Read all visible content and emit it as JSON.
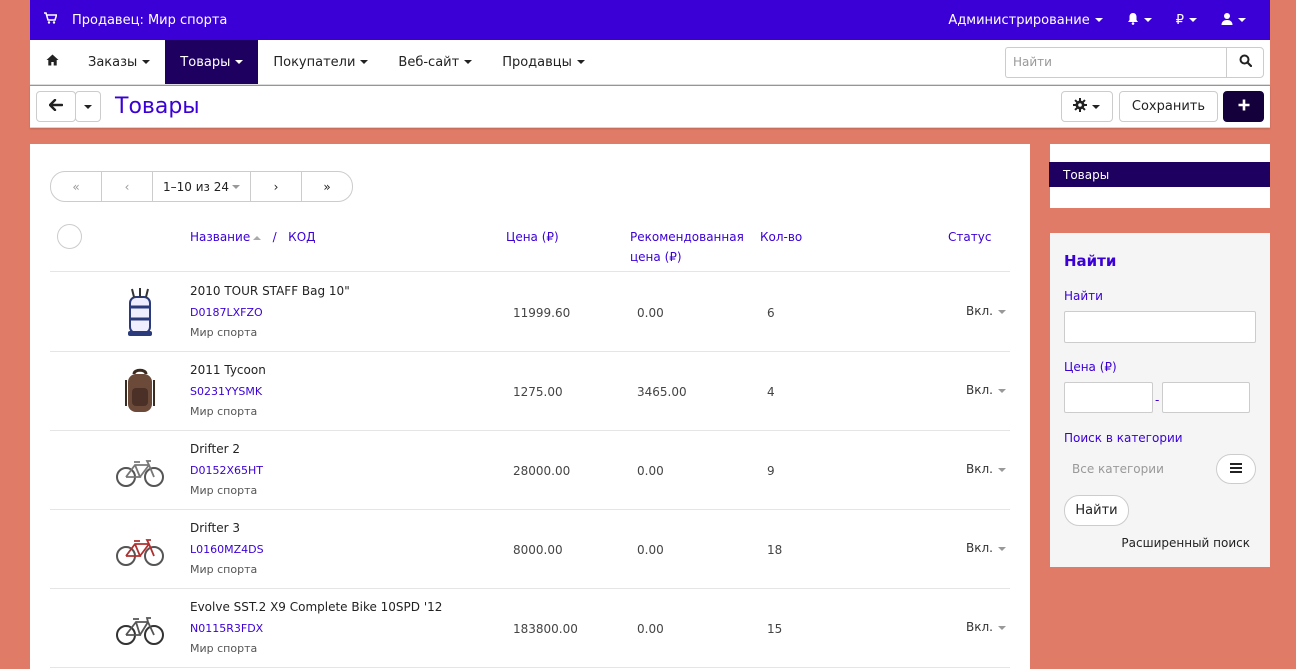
{
  "topbar": {
    "vendor": "Продавец: Мир спорта",
    "admin_label": "Администрирование",
    "currency_label": "₽"
  },
  "navbar": {
    "items": [
      {
        "label": "Заказы"
      },
      {
        "label": "Товары"
      },
      {
        "label": "Покупатели"
      },
      {
        "label": "Веб-сайт"
      },
      {
        "label": "Продавцы"
      }
    ],
    "active": "Товары",
    "search_placeholder": "Найти"
  },
  "titlebar": {
    "title": "Товары",
    "save_label": "Сохранить"
  },
  "pager": {
    "first": "«",
    "prev": "‹",
    "range": "1–10 из 24",
    "next": "›",
    "last": "»"
  },
  "table": {
    "headers": {
      "name": "Название",
      "separator": "/",
      "code": "КОД",
      "price": "Цена (₽)",
      "recommended_line1": "Рекомендованная",
      "recommended_line2": "цена (₽)",
      "qty": "Кол-во",
      "status": "Статус"
    },
    "rows": [
      {
        "name": "2010 TOUR STAFF Bag 10\"",
        "code": "D0187LXFZO",
        "vendor": "Мир спорта",
        "price": "11999.60",
        "recommended": "0.00",
        "qty": "6",
        "status": "Вкл.",
        "image": "golf-bag-icon"
      },
      {
        "name": "2011 Tycoon",
        "code": "S0231YYSMK",
        "vendor": "Мир спорта",
        "price": "1275.00",
        "recommended": "3465.00",
        "qty": "4",
        "status": "Вкл.",
        "image": "backpack-icon"
      },
      {
        "name": "Drifter 2",
        "code": "D0152X65HT",
        "vendor": "Мир спорта",
        "price": "28000.00",
        "recommended": "0.00",
        "qty": "9",
        "status": "Вкл.",
        "image": "bicycle-icon"
      },
      {
        "name": "Drifter 3",
        "code": "L0160MZ4DS",
        "vendor": "Мир спорта",
        "price": "8000.00",
        "recommended": "0.00",
        "qty": "18",
        "status": "Вкл.",
        "image": "bicycle-icon"
      },
      {
        "name": "Evolve SST.2 X9 Complete Bike 10SPD '12",
        "code": "N0115R3FDX",
        "vendor": "Мир спорта",
        "price": "183800.00",
        "recommended": "0.00",
        "qty": "15",
        "status": "Вкл.",
        "image": "bicycle-icon"
      }
    ]
  },
  "sidebar": {
    "selected_item": "Товары",
    "search": {
      "title": "Найти",
      "find_label": "Найти",
      "price_label": "Цена (₽)",
      "range_separator": "-",
      "category_label": "Поиск в категории",
      "category_placeholder": "Все категории",
      "find_button": "Найти",
      "advanced": "Расширенный поиск"
    }
  },
  "colors": {
    "accent": "#3a00d6",
    "dark_accent": "#1e0060",
    "background": "#e07b67"
  }
}
